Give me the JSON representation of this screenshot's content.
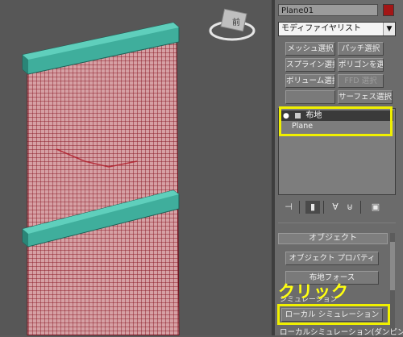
{
  "panel": {
    "object_name": "Plane01",
    "object_color": "#a31616",
    "modifier_list": "モディファイヤリスト",
    "modifier_list_arrow": "▼",
    "buttons": {
      "mesh_select": "メッシュ選択",
      "patch_select": "パッチ選択",
      "spline_select": "スプライン選択",
      "poly_select": "ポリゴンを選択",
      "volume_select": "ボリューム選択",
      "ffd_select": "FFD 選択",
      "blank": "",
      "surface_select": "サーフェス選択"
    },
    "stack": {
      "modifier": "布地",
      "base": "Plane"
    },
    "rollout": {
      "title": "オブジェクト",
      "object_properties": "オブジェクト プロパティ",
      "cloth_forces": "布地フォース",
      "cut_label": "シミュレーション",
      "local_simulation": "ローカル シミュレーション",
      "bottom_text": "ローカルシミュレーション(ダンピング)"
    }
  },
  "annotation": {
    "click": "クリック",
    "color": "#f0f000"
  },
  "viewcube": {
    "face": "前"
  }
}
